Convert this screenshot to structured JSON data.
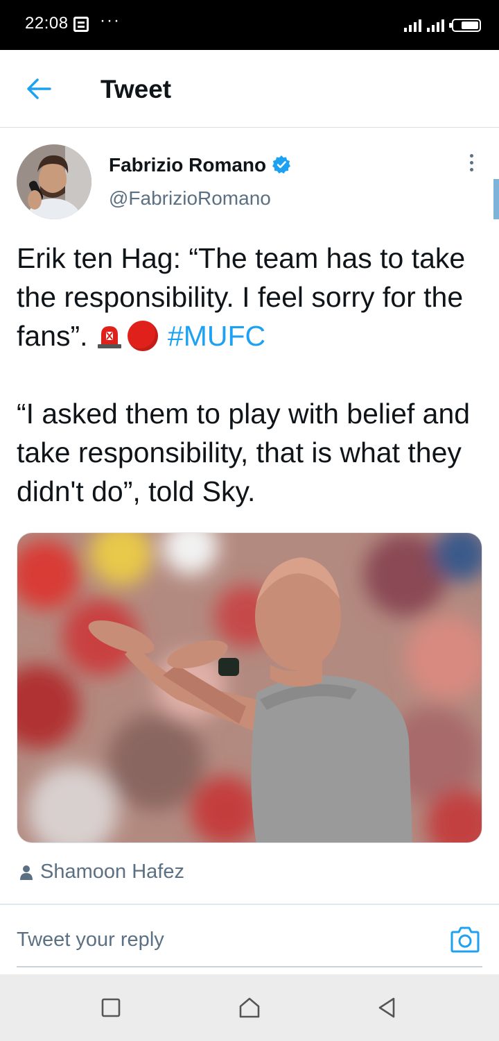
{
  "status_bar": {
    "time": "22:08",
    "dots": "···"
  },
  "header": {
    "title": "Tweet"
  },
  "author": {
    "name": "Fabrizio Romano",
    "handle": "@FabrizioRomano"
  },
  "tweet": {
    "line1": "Erik ten Hag: “The team has to take the responsibility. I feel sorry for the fans”.",
    "hashtag": "#MUFC",
    "line2": "“I asked them to play with belief and take responsibility, that is what they didn't do”, told Sky."
  },
  "media": {
    "credit": "Shamoon Hafez"
  },
  "reply": {
    "placeholder": "Tweet your reply"
  },
  "colors": {
    "accent": "#1da1f2",
    "text": "#0f1419",
    "secondary": "#5b7083"
  }
}
